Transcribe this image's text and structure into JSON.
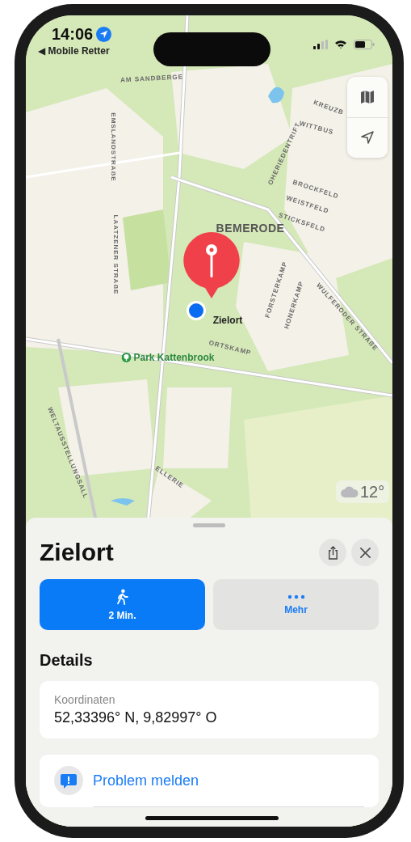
{
  "status_bar": {
    "time": "14:06",
    "back_link": "◀ Mobile Retter"
  },
  "map": {
    "labels": [
      {
        "text": "AM SANDBERGE",
        "kind": "street"
      },
      {
        "text": "EMSLANDSTRAẞE",
        "kind": "street"
      },
      {
        "text": "LAATZENER STRAẞE",
        "kind": "street"
      },
      {
        "text": "OHERIEDENTRIFT",
        "kind": "street"
      },
      {
        "text": "KREUZB",
        "kind": "street"
      },
      {
        "text": "WITTBUS",
        "kind": "street"
      },
      {
        "text": "BROCKFELD",
        "kind": "street"
      },
      {
        "text": "WEISTFELD",
        "kind": "street"
      },
      {
        "text": "STICKSFELD",
        "kind": "street"
      },
      {
        "text": "BEMERODE",
        "kind": "district"
      },
      {
        "text": "FORSTERKAMP",
        "kind": "street"
      },
      {
        "text": "HONERKAMP",
        "kind": "street"
      },
      {
        "text": "WULFERODER STRAẞE",
        "kind": "street"
      },
      {
        "text": "Zielort",
        "kind": "pin"
      },
      {
        "text": "ORTSKAMP",
        "kind": "street"
      },
      {
        "text": "Park Kattenbrook",
        "kind": "park"
      },
      {
        "text": "WELTAUSSTELLUNGSALL",
        "kind": "street"
      },
      {
        "text": "ELLERIE",
        "kind": "street"
      }
    ],
    "weather": {
      "temperature": "12°"
    }
  },
  "place_sheet": {
    "title": "Zielort",
    "actions": [
      {
        "kind": "walk",
        "label": "2 Min."
      },
      {
        "kind": "more",
        "label": "Mehr"
      }
    ],
    "details_heading": "Details",
    "coordinates": {
      "label": "Koordinaten",
      "value": "52,33396° N, 9,82997° O"
    },
    "links": [
      {
        "kind": "report",
        "label": "Problem melden"
      }
    ]
  }
}
